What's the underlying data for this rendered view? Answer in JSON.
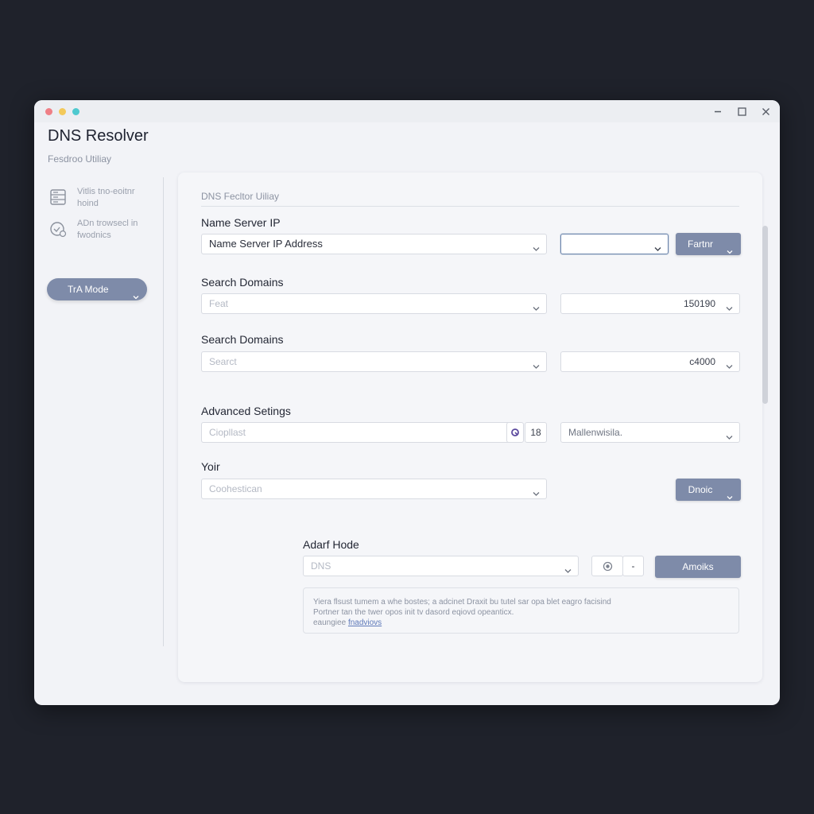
{
  "window": {
    "title": "DNS Resolver",
    "subtitle": "Fesdroo Utiliay"
  },
  "sidebar": {
    "items": [
      {
        "label_line1": "Vitlis tno-eoitnr",
        "label_line2": "hoind",
        "icon": "server-icon"
      },
      {
        "label_line1": "ADn trowsecl in",
        "label_line2": "fwodnics",
        "icon": "network-refresh-icon"
      }
    ],
    "mode_button": "TrA Mode"
  },
  "panel": {
    "title": "DNS Fecltor Uiliay",
    "name_server": {
      "label": "Name Server IP",
      "select_value": "Name Server IP Address",
      "secondary_value": "",
      "button": "Fartnr"
    },
    "search_domains_1": {
      "label": "Search Domains",
      "placeholder": "Feat",
      "value": "150190"
    },
    "search_domains_2": {
      "label": "Search Domains",
      "placeholder": "Searct",
      "value": "c4000"
    },
    "advanced": {
      "label": "Advanced Setings",
      "placeholder": "Ciopllast",
      "count": "18",
      "select_value": "Mallenwisila."
    },
    "your": {
      "label": "Yoir",
      "placeholder": "Coohestican",
      "button": "Dnoic"
    },
    "adaf_mode": {
      "label": "Adarf Hode",
      "placeholder": "DNS",
      "stepper_minus": "-",
      "button": "Amoiks"
    },
    "info": {
      "line1": "Yiera flsust tumem a whe bostes; a adcinet Draxit bu tutel sar opa blet eagro facisind",
      "line2": "Portner tan the twer opos init tv dasord eqiovd opeanticx.",
      "line3_text": "eaungiee",
      "line3_link": "fnadviovs"
    }
  },
  "colors": {
    "accent": "#7e8ba9",
    "background": "#1f222b",
    "window": "#f2f3f7"
  }
}
